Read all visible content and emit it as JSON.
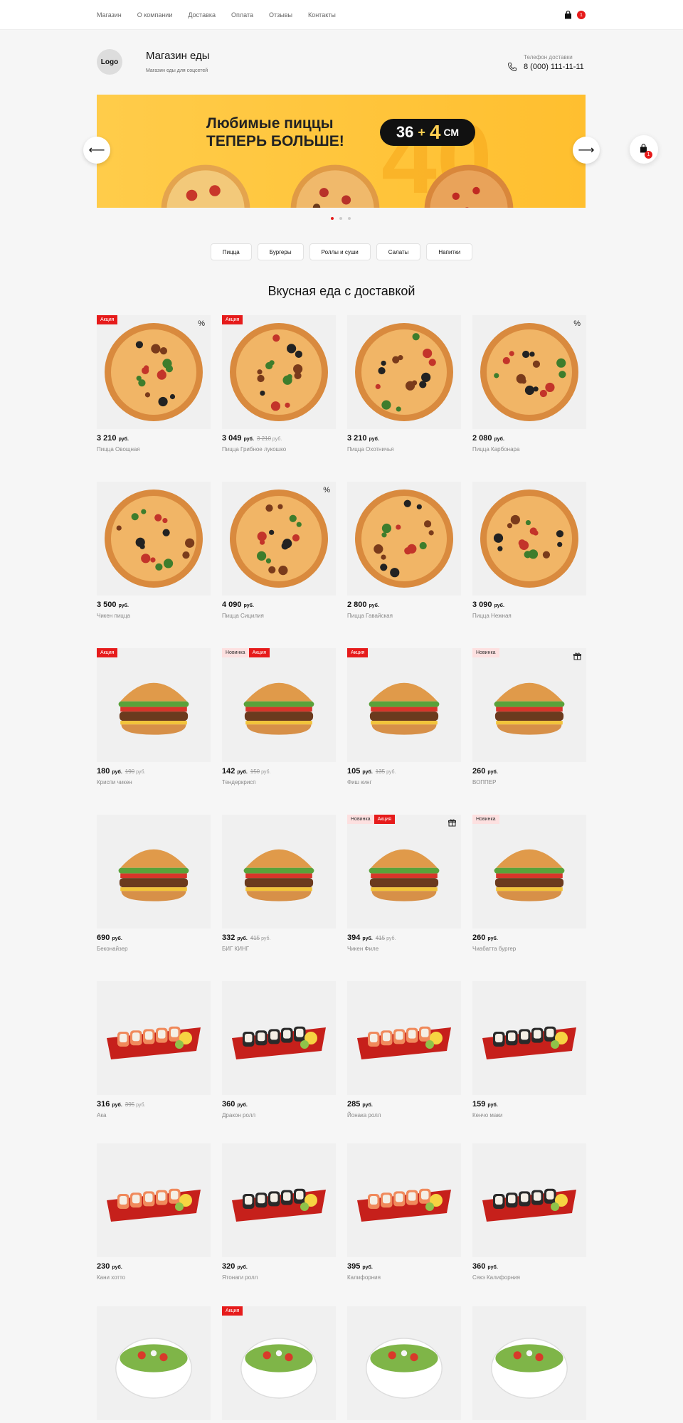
{
  "nav": {
    "items": [
      "Магазин",
      "О компании",
      "Доставка",
      "Оплата",
      "Отзывы",
      "Контакты"
    ],
    "cart_count": "1"
  },
  "header": {
    "logo": "Logo",
    "title": "Магазин еды",
    "subtitle": "Магазин еды для соцсетей",
    "phone_label": "Телефон доставки",
    "phone": "8 (000) 111-11-11"
  },
  "banner": {
    "line1": "Любимые пиццы",
    "line2": "ТЕПЕРЬ БОЛЬШЕ!",
    "size_a": "36",
    "plus": "+",
    "size_b": "4",
    "unit": "СМ",
    "big": "40",
    "prev_arrow": "⟵",
    "next_arrow": "⟶",
    "slides_active": 1
  },
  "float_cart_count": "1",
  "categories": [
    "Пицца",
    "Бургеры",
    "Роллы и суши",
    "Салаты",
    "Напитки"
  ],
  "section_title": "Вкусная еда с доставкой",
  "labels": {
    "sale": "Акция",
    "new": "Новинка",
    "rub": "руб.",
    "percent": "%"
  },
  "products": [
    {
      "kind": "pizza",
      "price": "3 210",
      "old": "",
      "name": "Пицца Овощная",
      "tags": [
        "sale"
      ],
      "percent": true,
      "gift": false
    },
    {
      "kind": "pizza",
      "price": "3 049",
      "old": "3 210",
      "name": "Пицца Грибное лукошко",
      "tags": [
        "sale"
      ],
      "percent": false,
      "gift": false
    },
    {
      "kind": "pizza",
      "price": "3 210",
      "old": "",
      "name": "Пицца Охотничья",
      "tags": [],
      "percent": false,
      "gift": false
    },
    {
      "kind": "pizza",
      "price": "2 080",
      "old": "",
      "name": "Пицца Карбонара",
      "tags": [],
      "percent": true,
      "gift": false
    },
    {
      "kind": "pizza",
      "price": "3 500",
      "old": "",
      "name": "Чикен пицца",
      "tags": [],
      "percent": false,
      "gift": false
    },
    {
      "kind": "pizza",
      "price": "4 090",
      "old": "",
      "name": "Пицца Сицилия",
      "tags": [],
      "percent": true,
      "gift": false
    },
    {
      "kind": "pizza",
      "price": "2 800",
      "old": "",
      "name": "Пицца Гавайская",
      "tags": [],
      "percent": false,
      "gift": false
    },
    {
      "kind": "pizza",
      "price": "3 090",
      "old": "",
      "name": "Пицца Нежная",
      "tags": [],
      "percent": false,
      "gift": false
    },
    {
      "kind": "burger",
      "price": "180",
      "old": "190",
      "name": "Криспи чикен",
      "tags": [
        "sale"
      ],
      "percent": false,
      "gift": false
    },
    {
      "kind": "burger",
      "price": "142",
      "old": "150",
      "name": "Тендеркрисп",
      "tags": [
        "new",
        "sale"
      ],
      "percent": false,
      "gift": false
    },
    {
      "kind": "burger",
      "price": "105",
      "old": "135",
      "name": "Фиш кинг",
      "tags": [
        "sale"
      ],
      "percent": false,
      "gift": false
    },
    {
      "kind": "burger",
      "price": "260",
      "old": "",
      "name": "ВОППЕР",
      "tags": [
        "new"
      ],
      "percent": false,
      "gift": true
    },
    {
      "kind": "burger",
      "price": "690",
      "old": "",
      "name": "Беконайзер",
      "tags": [],
      "percent": false,
      "gift": false
    },
    {
      "kind": "burger",
      "price": "332",
      "old": "415",
      "name": "БИГ КИНГ",
      "tags": [],
      "percent": false,
      "gift": false
    },
    {
      "kind": "burger",
      "price": "394",
      "old": "415",
      "name": "Чикен Филе",
      "tags": [
        "new",
        "sale"
      ],
      "percent": false,
      "gift": true
    },
    {
      "kind": "burger",
      "price": "260",
      "old": "",
      "name": "Чиабатта бургер",
      "tags": [
        "new"
      ],
      "percent": false,
      "gift": false
    },
    {
      "kind": "roll",
      "price": "316",
      "old": "395",
      "name": "Ака",
      "tags": [],
      "percent": false,
      "gift": false
    },
    {
      "kind": "roll",
      "price": "360",
      "old": "",
      "name": "Дракон ролл",
      "tags": [],
      "percent": false,
      "gift": false
    },
    {
      "kind": "roll",
      "price": "285",
      "old": "",
      "name": "Йонака ролл",
      "tags": [],
      "percent": false,
      "gift": false
    },
    {
      "kind": "roll",
      "price": "159",
      "old": "",
      "name": "Кенчо маки",
      "tags": [],
      "percent": false,
      "gift": false
    },
    {
      "kind": "roll",
      "price": "230",
      "old": "",
      "name": "Кани хотто",
      "tags": [],
      "percent": false,
      "gift": false
    },
    {
      "kind": "roll",
      "price": "320",
      "old": "",
      "name": "Ятонаги ролл",
      "tags": [],
      "percent": false,
      "gift": false
    },
    {
      "kind": "roll",
      "price": "395",
      "old": "",
      "name": "Калифорния",
      "tags": [],
      "percent": false,
      "gift": false
    },
    {
      "kind": "roll",
      "price": "360",
      "old": "",
      "name": "Сякэ Калифорния",
      "tags": [],
      "percent": false,
      "gift": false
    },
    {
      "kind": "salad",
      "price": "",
      "old": "",
      "name": "",
      "tags": [],
      "percent": false,
      "gift": false
    },
    {
      "kind": "salad",
      "price": "",
      "old": "",
      "name": "",
      "tags": [
        "sale"
      ],
      "percent": false,
      "gift": false
    },
    {
      "kind": "salad",
      "price": "",
      "old": "",
      "name": "",
      "tags": [],
      "percent": false,
      "gift": false
    },
    {
      "kind": "salad",
      "price": "",
      "old": "",
      "name": "",
      "tags": [],
      "percent": false,
      "gift": false
    }
  ],
  "colors": {
    "accent": "#e61b1b",
    "banner": "#ffc13a",
    "background": "#f6f6f6"
  }
}
